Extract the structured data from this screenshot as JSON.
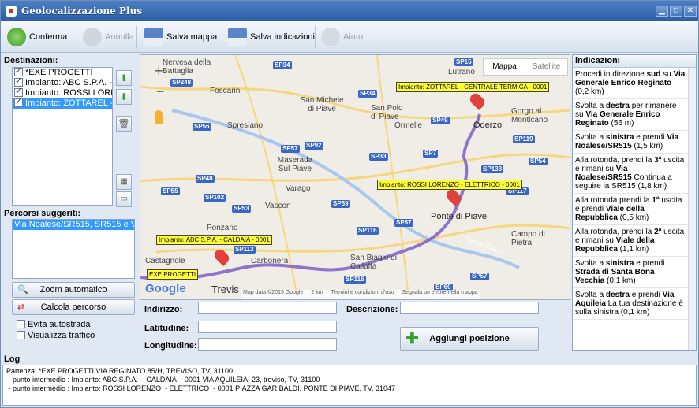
{
  "window": {
    "title": "Geolocalizzazione Plus"
  },
  "toolbar": {
    "confirm": "Conferma",
    "cancel": "Annulla",
    "save_map": "Salva mappa",
    "save_directions": "Salva indicazioni",
    "help": "Aiuto"
  },
  "destinations": {
    "label": "Destinazioni:",
    "items": [
      {
        "label": "*EXE PROGETTI",
        "checked": true,
        "selected": false
      },
      {
        "label": "Impianto: ABC S.P.A.  - C",
        "checked": true,
        "selected": false
      },
      {
        "label": "Impianto: ROSSI LORENZ",
        "checked": true,
        "selected": false
      },
      {
        "label": "Impianto: ZOTTAREL  - (",
        "checked": true,
        "selected": true
      }
    ]
  },
  "routes": {
    "label": "Percorsi suggeriti:",
    "items": [
      "Via Noalese/SR515, SR515 e Viale"
    ]
  },
  "buttons": {
    "zoom": "Zoom automatico",
    "calc": "Calcola percorso"
  },
  "options": {
    "avoid_highway": "Evita autostrada",
    "show_traffic": "Visualizza traffico"
  },
  "map": {
    "type_map": "Mappa",
    "type_sat": "Satellite",
    "shields": [
      "SP34",
      "SP15",
      "SP248",
      "SP34",
      "SP49",
      "SP56",
      "SP119",
      "SP57",
      "SP92",
      "SP7",
      "SP54",
      "SP33",
      "SP133",
      "SP48",
      "SP55",
      "SP102",
      "SP117",
      "SP59",
      "SP53",
      "SP57",
      "SP116",
      "SP113",
      "SP116",
      "SP57",
      "SP60"
    ],
    "towns": [
      "Nervesa della Battaglia",
      "Lutrano",
      "Foscarini",
      "San Michele di Piave",
      "San Polo di Piave",
      "Gorgo al Monticano",
      "Spresiano",
      "Ormelle",
      "Oderzo",
      "Maserada Sul Piave",
      "Varago",
      "Vascon",
      "Ponte di Piave",
      "Campo di Pietra",
      "Ponzano",
      "Carbonera",
      "San Biagio di Callalta",
      "Castagnole",
      "Trevis"
    ],
    "markers": [
      "Impianto: ZOTTAREL - CENTRALE TERMICA - 0001",
      "Impianto: ROSSI LORENZO - ELETTRICO - 0001",
      "Impianto: ABC S.P.A. - CALDAIA - 0001",
      "EXE PROGETTI"
    ],
    "footer": {
      "copyright": "Map data ©2015 Google",
      "scale": "2 km",
      "terms": "Termini e condizioni d'uso",
      "report": "Segnala un errore nella mappa"
    },
    "logo": "Google",
    "river": "Fiume Piave"
  },
  "form": {
    "address": "Indirizzo:",
    "description": "Descrizione:",
    "latitude": "Latitudine:",
    "longitude": "Longitudine:",
    "add": "Aggiungi posizione"
  },
  "directions": {
    "label": "Indicazioni"
  },
  "log": {
    "label": "Log",
    "text": "Partenza: *EXE PROGETTI VIA REGINATO 85/H, TREVISO, TV, 31100\n - punto intermedio : Impianto: ABC S.P.A.  - CALDAIA  - 0001 VIA AQUILEIA, 23, treviso, TV, 31100\n - punto intermedio : Impianto: ROSSI LORENZO  - ELETTRICO  - 0001 PIAZZA GARIBALDI, PONTE DI PIAVE, TV, 31047"
  }
}
